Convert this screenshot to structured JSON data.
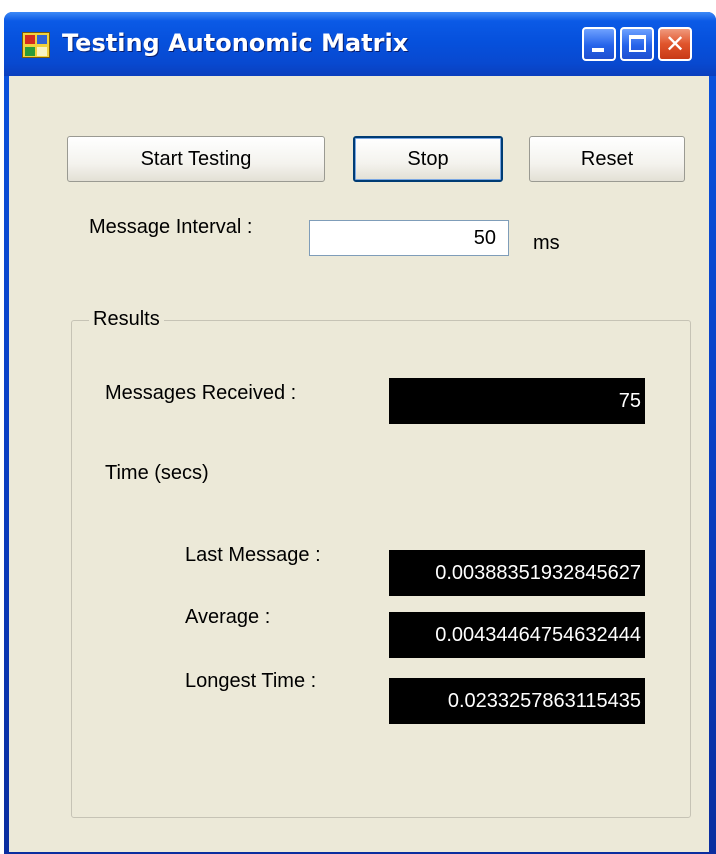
{
  "window": {
    "title": "Testing Autonomic Matrix"
  },
  "toolbar": {
    "start_label": "Start Testing",
    "stop_label": "Stop",
    "reset_label": "Reset"
  },
  "interval": {
    "label": "Message Interval :",
    "value": "50",
    "unit": "ms"
  },
  "results": {
    "group_title": "Results",
    "messages_received_label": "Messages Received :",
    "messages_received_value": "75",
    "time_label": "Time (secs)",
    "last_message_label": "Last Message :",
    "last_message_value": "0.00388351932845627",
    "average_label": "Average :",
    "average_value": "0.00434464754632444",
    "longest_time_label": "Longest Time :",
    "longest_time_value": "0.0233257863115435"
  },
  "icons": {
    "app": "app-icon",
    "minimize": "minimize-icon",
    "maximize": "maximize-icon",
    "close": "close-icon"
  },
  "colors": {
    "titlebar": "#0651dd",
    "client_background": "#ece9d8",
    "output_background": "#000000",
    "output_text": "#ffffff",
    "close_button": "#e0542b"
  }
}
